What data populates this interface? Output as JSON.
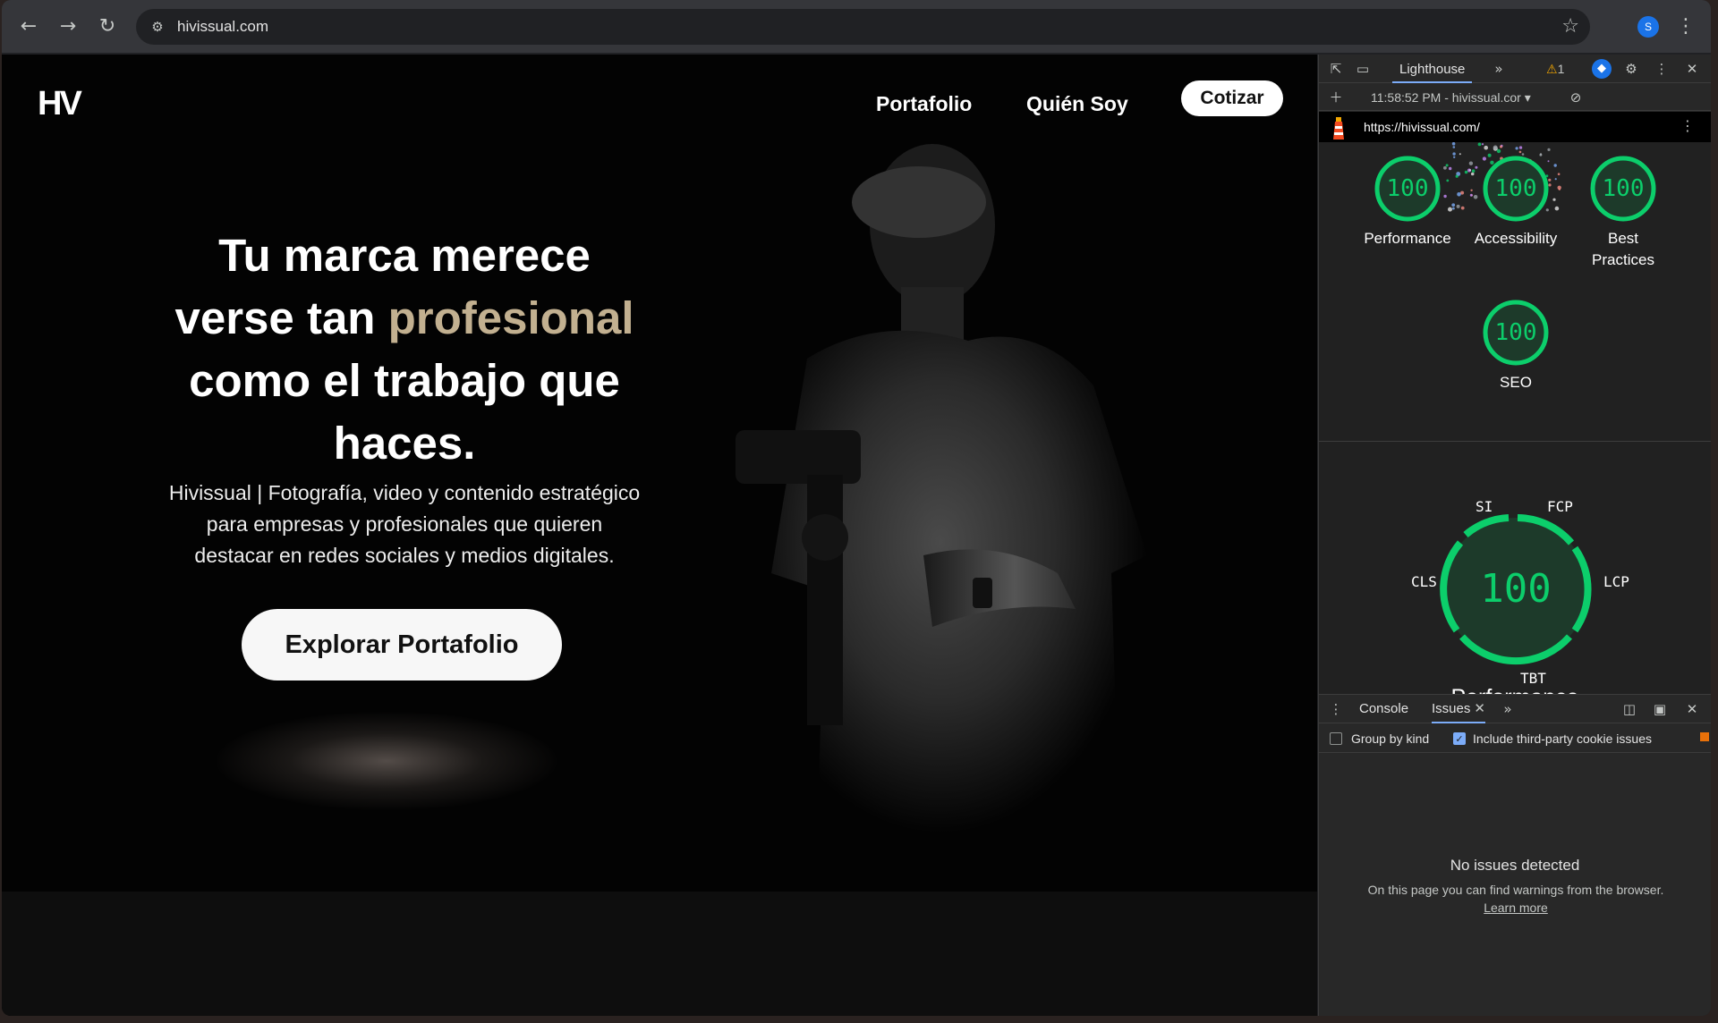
{
  "browser": {
    "url": "hivissual.com",
    "profile_initial": "S"
  },
  "site": {
    "logo": "HV",
    "nav": [
      "Portafolio",
      "Quién Soy"
    ],
    "nav_cta": "Cotizar",
    "headline_line1": "Tu marca merece",
    "headline_line2_pre": "verse tan ",
    "headline_line2_accent": "profesional",
    "headline_line3": "como el trabajo que",
    "headline_line4": "haces.",
    "subtext_line1": "Hivissual | Fotografía, video y contenido estratégico",
    "subtext_line2": "para empresas y profesionales que quieren",
    "subtext_line3": "destacar en redes sociales y medios digitales.",
    "hero_button": "Explorar Portafolio",
    "accent_color": "#c2b090"
  },
  "devtools": {
    "active_panel": "Lighthouse",
    "warning_count": "1",
    "report_time": "11:58:52 PM - hivissual.cor",
    "report_url": "https://hivissual.com/",
    "scores": [
      {
        "label": "Performance",
        "value": "100"
      },
      {
        "label": "Accessibility",
        "value": "100"
      },
      {
        "label": "Best Practices",
        "label_line1": "Best",
        "label_line2": "Practices",
        "value": "100"
      },
      {
        "label": "SEO",
        "value": "100"
      }
    ],
    "performance": {
      "score": "100",
      "title": "Performance",
      "metrics": [
        "SI",
        "FCP",
        "LCP",
        "TBT",
        "CLS"
      ]
    },
    "score_color": "#0cce6b",
    "drawer": {
      "tabs": [
        "Console",
        "Issues"
      ],
      "group_by_kind": "Group by kind",
      "include_third_party": "Include third-party cookie issues",
      "group_by_kind_checked": false,
      "include_third_party_checked": true,
      "no_issues_title": "No issues detected",
      "no_issues_text": "On this page you can find warnings from the browser.",
      "learn_more": "Learn more"
    }
  }
}
